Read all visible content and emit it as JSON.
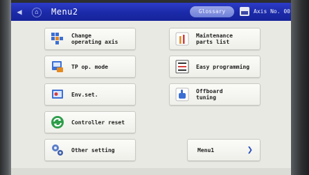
{
  "window": {
    "title": "Menu2"
  },
  "header": {
    "glossary_label": "Glossary",
    "axis_label": "Axis No. 00"
  },
  "menu": {
    "change_axis": "Change\noperating axis",
    "maintenance": "Maintenance\nparts list",
    "tp_mode": "TP op. mode",
    "easy_programming": "Easy programming",
    "env_set": "Env.set.",
    "offboard_tuning": "Offboard\ntuning",
    "controller_reset": "Controller reset",
    "other_setting": "Other setting",
    "menu1": "Menu1"
  },
  "icons": {
    "back": "back-arrow-icon",
    "home": "home-icon",
    "axis": "axis-monitor-icon",
    "change_axis": "axis-grid-icon",
    "maintenance": "tools-icon",
    "tp_mode": "pendant-icon",
    "easy_programming": "program-list-icon",
    "env_set": "settings-panel-icon",
    "offboard_tuning": "hand-tuning-icon",
    "controller_reset": "reset-cycle-icon",
    "other_setting": "gears-icon",
    "menu1": "chevron-right-icon"
  },
  "colors": {
    "title_bar": "#1f2db0",
    "screen_bg": "#e9e9e4",
    "chevron": "#2a4fbf"
  }
}
